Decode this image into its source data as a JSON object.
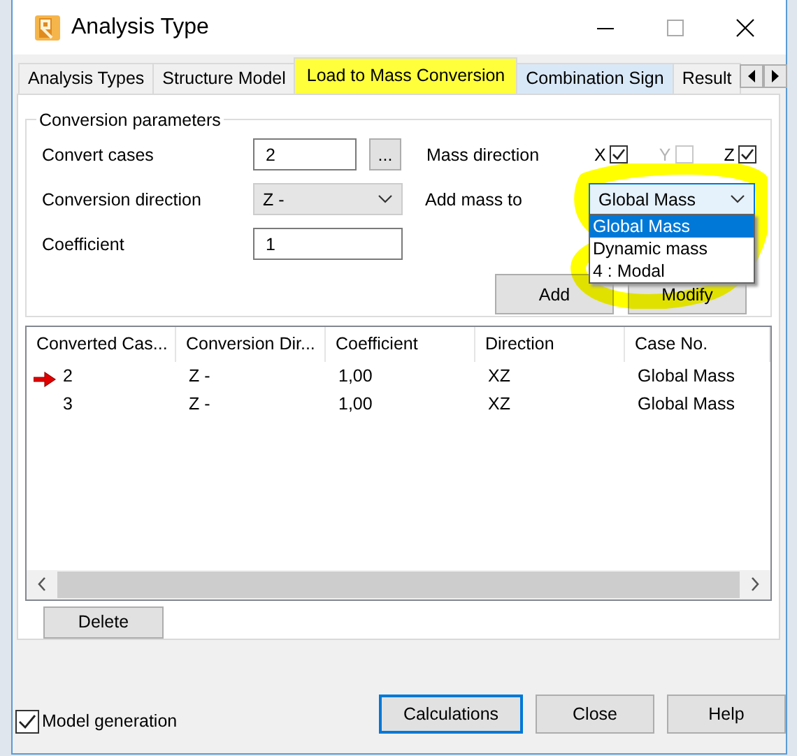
{
  "window": {
    "title": "Analysis Type"
  },
  "tabs": [
    {
      "label": "Analysis Types",
      "selected": false,
      "highlighted": false
    },
    {
      "label": "Structure Model",
      "selected": false,
      "highlighted": false
    },
    {
      "label": "Load to Mass Conversion",
      "selected": true,
      "highlighted": true
    },
    {
      "label": "Combination Sign",
      "selected": false,
      "highlighted": false
    },
    {
      "label": "Result",
      "selected": false,
      "highlighted": false
    }
  ],
  "conversion_parameters": {
    "title": "Conversion parameters",
    "convert_cases": {
      "label": "Convert cases",
      "value": "2",
      "browse_button": "..."
    },
    "conversion_direction": {
      "label": "Conversion direction",
      "value": "Z -"
    },
    "coefficient": {
      "label": "Coefficient",
      "value": "1"
    },
    "mass_direction": {
      "label": "Mass direction",
      "axes": [
        {
          "label": "X",
          "checked": true,
          "disabled": false
        },
        {
          "label": "Y",
          "checked": false,
          "disabled": true
        },
        {
          "label": "Z",
          "checked": true,
          "disabled": false
        }
      ]
    },
    "add_mass_to": {
      "label": "Add mass to",
      "value": "Global Mass",
      "expanded": true,
      "highlighted": true,
      "options": [
        {
          "label": "Global Mass",
          "selected": true
        },
        {
          "label": "Dynamic mass",
          "selected": false
        },
        {
          "label": "4 : Modal",
          "selected": false
        }
      ]
    },
    "buttons": [
      "Add",
      "Modify"
    ]
  },
  "table": {
    "columns": [
      "Converted Cas...",
      "Conversion Dir...",
      "Coefficient",
      "Direction",
      "Case No."
    ],
    "rows": [
      {
        "current": true,
        "cells": [
          "2",
          "Z -",
          "1,00",
          "XZ",
          "Global Mass"
        ]
      },
      {
        "current": false,
        "cells": [
          "3",
          "Z -",
          "1,00",
          "XZ",
          "Global Mass"
        ]
      }
    ]
  },
  "delete_button": "Delete",
  "model_generation": {
    "label": "Model generation",
    "checked": true
  },
  "buttons": [
    {
      "label": "Calculations",
      "focused": true
    },
    {
      "label": "Close",
      "focused": false
    },
    {
      "label": "Help",
      "focused": false
    }
  ]
}
